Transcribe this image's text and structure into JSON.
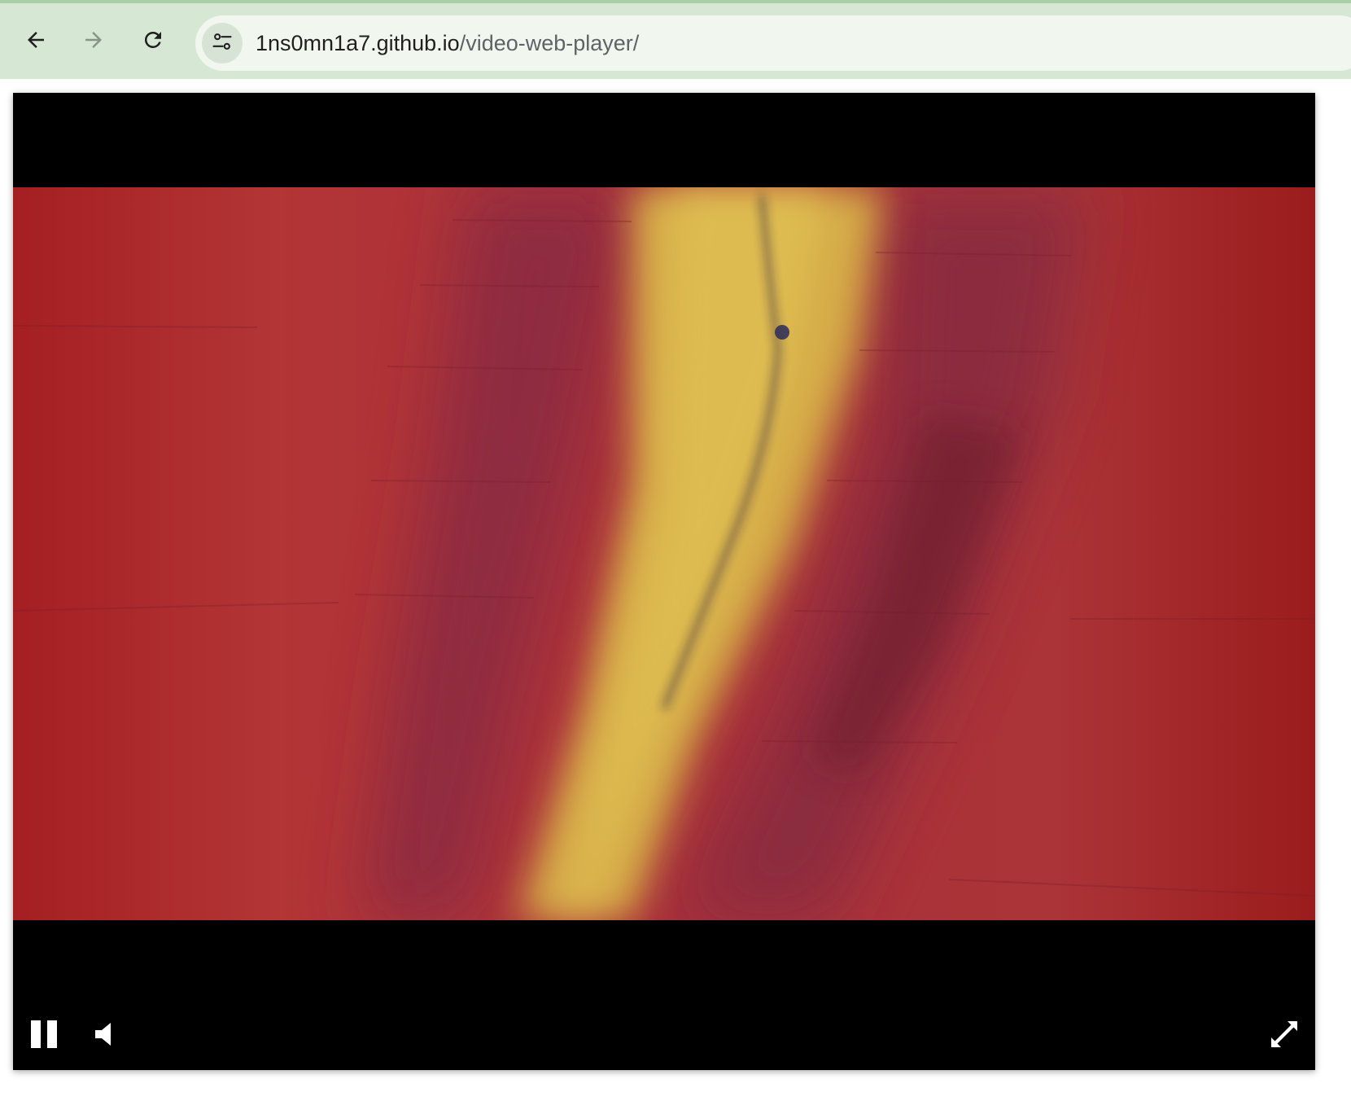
{
  "browser": {
    "url_host": "1ns0mn1a7.github.io",
    "url_path": "/video-web-player/",
    "icons": {
      "back": "arrow-left-icon",
      "forward": "arrow-right-icon",
      "reload": "reload-icon",
      "site_info": "tune-icon"
    }
  },
  "player": {
    "state": "playing",
    "controls": {
      "play_pause": "pause-icon",
      "volume": "volume-icon",
      "fullscreen": "fullscreen-icon"
    }
  },
  "colors": {
    "chrome_bg": "#d6e8d4",
    "omnibox_bg": "#f1f7ef",
    "player_bg": "#000000",
    "video_red": "#a8262a",
    "video_yellow": "#d8b24a",
    "video_magenta": "#8c2f45"
  }
}
